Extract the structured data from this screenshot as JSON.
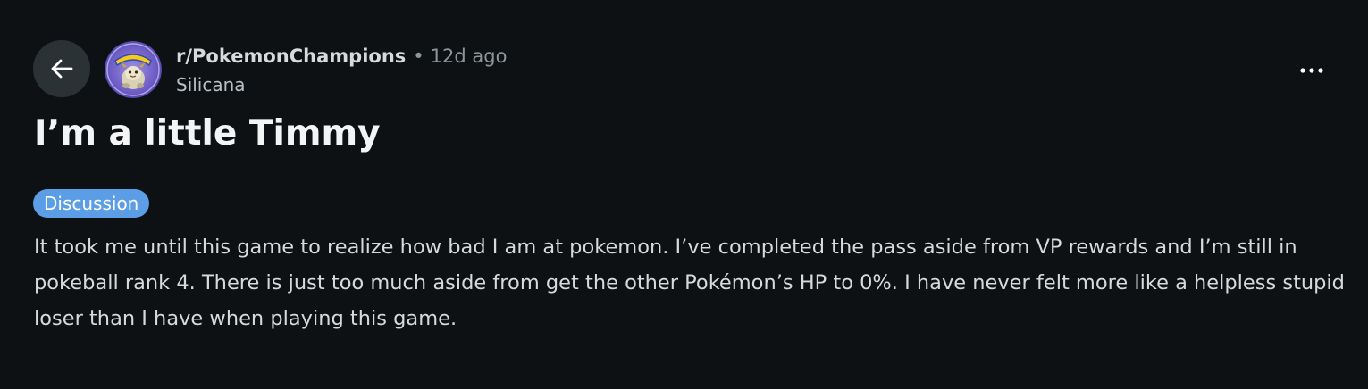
{
  "header": {
    "back_icon": "arrow-left-icon",
    "subreddit": "r/PokemonChampions",
    "separator": "•",
    "timestamp": "12d ago",
    "author": "Silicana",
    "overflow_icon": "more-horizontal-icon",
    "avatar_icon": "pokemon-subreddit-avatar"
  },
  "post": {
    "title": "I’m a little Timmy",
    "flair": "Discussion",
    "body": "It took me until this game to realize how bad I am at pokemon. I’ve completed the pass aside from VP rewards and I’m still in pokeball rank 4. There is just too much aside from get the other Pokémon’s HP to 0%. I have never felt more like a helpless stupid loser than I have when playing this game."
  },
  "colors": {
    "background": "#0e1113",
    "button_bg": "#2a3236",
    "flair_bg": "#5c9ee6",
    "text_primary": "#f2f4f5",
    "text_secondary": "#8c959a"
  }
}
